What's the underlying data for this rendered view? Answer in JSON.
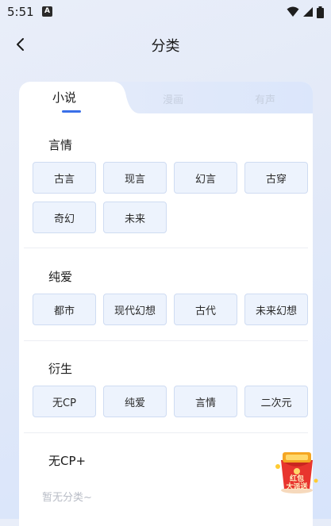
{
  "status": {
    "time": "5:51",
    "notification_icon": "A"
  },
  "header": {
    "title": "分类"
  },
  "tabs": [
    {
      "label": "小说",
      "active": true
    },
    {
      "label": "漫画",
      "active": false
    },
    {
      "label": "有声",
      "active": false
    }
  ],
  "sections": [
    {
      "title": "言情",
      "tags": [
        "古言",
        "现言",
        "幻言",
        "古穿",
        "奇幻",
        "未来"
      ]
    },
    {
      "title": "纯爱",
      "tags": [
        "都市",
        "现代幻想",
        "古代",
        "未来幻想"
      ]
    },
    {
      "title": "衍生",
      "tags": [
        "无CP",
        "纯爱",
        "言情",
        "二次元"
      ]
    },
    {
      "title": "无CP+",
      "empty_text": "暂无分类~"
    }
  ],
  "float_badge": {
    "line1": "红包",
    "line2": "大派送"
  },
  "colors": {
    "accent": "#3a6fe8",
    "tag_bg": "#edf3fd",
    "tag_border": "#cfdcf2",
    "badge_red": "#e8352e"
  }
}
